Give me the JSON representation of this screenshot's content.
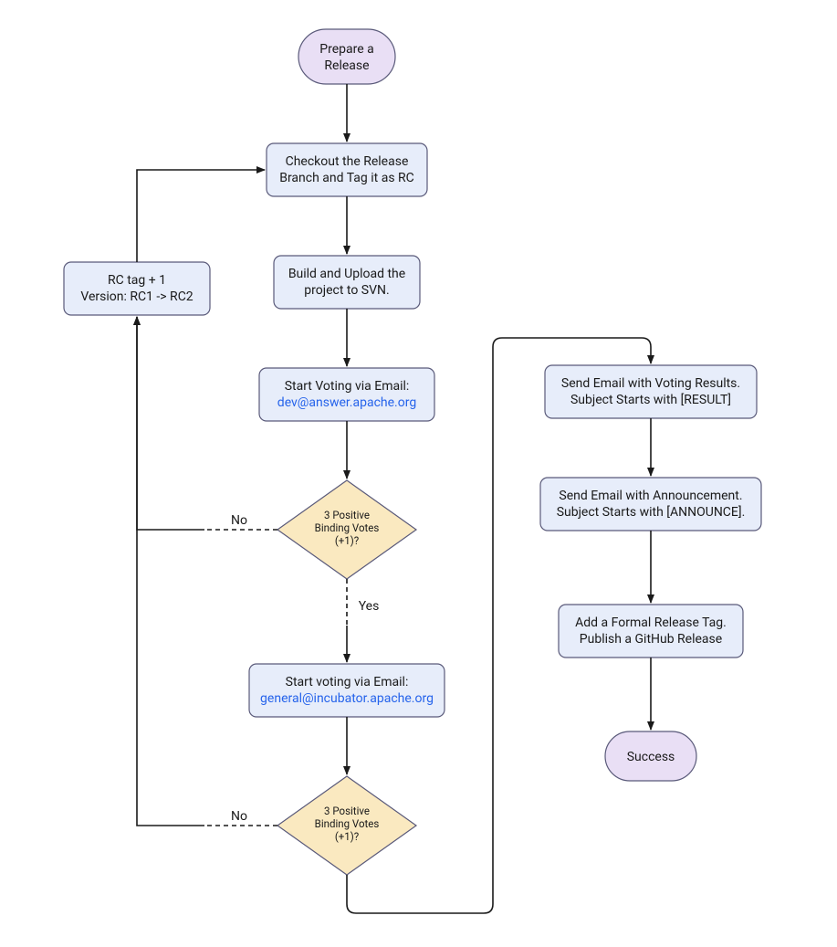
{
  "nodes": {
    "start": {
      "line1": "Prepare a",
      "line2": "Release"
    },
    "checkout": {
      "line1": "Checkout the Release",
      "line2": "Branch and Tag it as RC"
    },
    "build": {
      "line1": "Build and Upload the",
      "line2": "project to SVN."
    },
    "vote1": {
      "line1": "Start Voting via Email:",
      "email": "dev@answer.apache.org"
    },
    "decision1": {
      "line1": "3 Positive",
      "line2": "Binding Votes",
      "line3": "(+1)?"
    },
    "rcbump": {
      "line1": "RC tag + 1",
      "line2": "Version: RC1 -> RC2"
    },
    "vote2": {
      "line1": "Start voting via Email:",
      "email": "general@incubator.apache.org"
    },
    "decision2": {
      "line1": "3 Positive",
      "line2": "Binding Votes",
      "line3": "(+1)?"
    },
    "result": {
      "line1": "Send Email with Voting Results.",
      "line2": "Subject Starts with [RESULT]"
    },
    "announce": {
      "line1": "Send Email with Announcement.",
      "line2": "Subject Starts with [ANNOUNCE]."
    },
    "tag": {
      "line1": "Add a Formal Release Tag.",
      "line2": "Publish a GitHub Release"
    },
    "success": {
      "line1": "Success"
    }
  },
  "edgeLabels": {
    "no": "No",
    "yes": "Yes"
  }
}
